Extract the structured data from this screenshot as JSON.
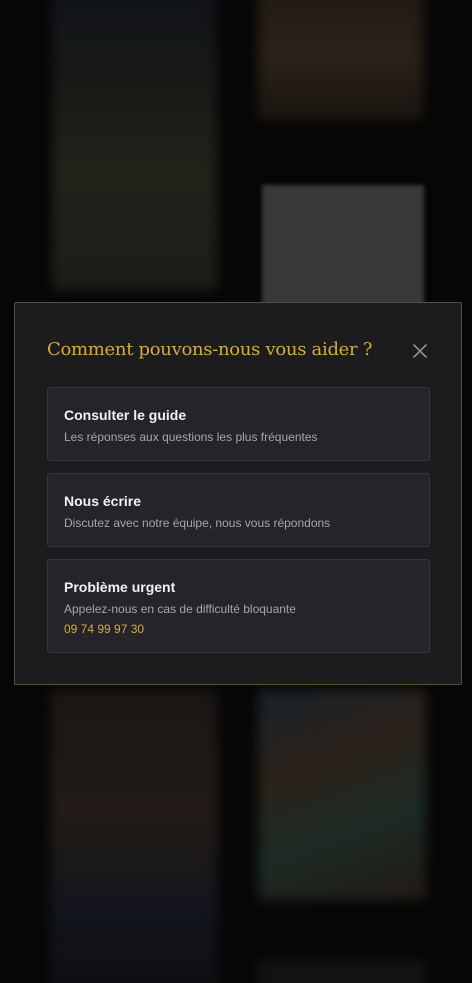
{
  "modal": {
    "title": "Comment pouvons-nous vous aider ?",
    "close_icon": "close-icon",
    "accent_color": "#d6ab3e",
    "options": [
      {
        "title": "Consulter le guide",
        "description": "Les réponses aux questions les plus fréquentes"
      },
      {
        "title": "Nous écrire",
        "description": "Discutez avec notre équipe, nous vous répondons"
      },
      {
        "title": "Problème urgent",
        "description": "Appelez-nous en cas de difficulté bloquante",
        "phone": "09 74 99 97 30"
      }
    ]
  }
}
